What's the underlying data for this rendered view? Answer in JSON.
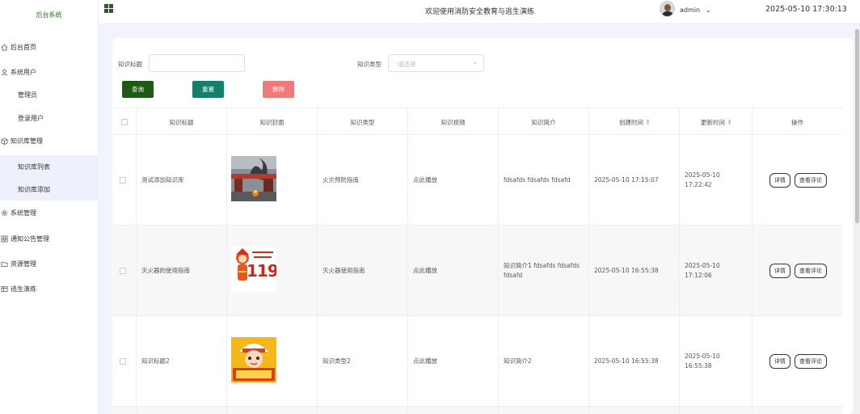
{
  "app": {
    "brand": "后台系统",
    "title": "欢迎使用消防安全教育与逃生演练",
    "user": "admin",
    "datetime": "2025-05-10 17:30:13"
  },
  "sidebar": {
    "items": [
      {
        "label": "后台首页",
        "icon": "home-icon"
      },
      {
        "label": "系统用户",
        "icon": "user-icon"
      },
      {
        "label": "管理员",
        "sub": true
      },
      {
        "label": "登录用户",
        "sub": true
      },
      {
        "label": "知识库管理",
        "icon": "box-icon"
      },
      {
        "label": "知识库列表",
        "sub": true,
        "active": true
      },
      {
        "label": "知识库添加",
        "sub": true,
        "active": true
      },
      {
        "label": "系统管理",
        "icon": "gear-icon"
      },
      {
        "label": "通知公告管理",
        "icon": "grid-icon"
      },
      {
        "label": "资源管理",
        "icon": "folder-icon"
      },
      {
        "label": "逃生演练",
        "icon": "table-icon"
      }
    ]
  },
  "filters": {
    "title_label": "知识标题",
    "title_value": "",
    "type_label": "知识类型",
    "type_placeholder": "请选择"
  },
  "buttons": {
    "query": "查询",
    "reset": "重置",
    "delete": "删除"
  },
  "colors": {
    "query": "#1e5a14",
    "reset": "#14806b",
    "delete": "#f07a7a"
  },
  "table": {
    "headers": [
      "知识标题",
      "知识封面",
      "知识类型",
      "知识视频",
      "知识简介",
      "创建时间",
      "更新时间",
      "操作"
    ],
    "rows": [
      {
        "title": "测试添加知识库",
        "cover": "fire-scene",
        "type": "火灾预防指南",
        "video": "点此播放",
        "intro": "fdsafds fdsafds fdsafd",
        "created": "2025-05-10 17:15:07",
        "updated": "2025-05-10 17:22:42"
      },
      {
        "title": "灭火器的使用指南",
        "cover": "mascot-119",
        "type": "灭火器使用指南",
        "video": "点此播放",
        "intro": "知识简介1 fdsafds fdsafds fdsafd",
        "created": "2025-05-10 16:55:38",
        "updated": "2025-05-10 17:12:06"
      },
      {
        "title": "知识标题2",
        "cover": "mascot-firefighter",
        "type": "知识类型2",
        "video": "点此播放",
        "intro": "知识简介2",
        "created": "2025-05-10 16:55:38",
        "updated": "2025-05-10 16:55:38"
      }
    ],
    "actions": {
      "detail": "详情",
      "review": "查看评论"
    }
  },
  "cover_texts": {
    "mascot_119": "119"
  }
}
